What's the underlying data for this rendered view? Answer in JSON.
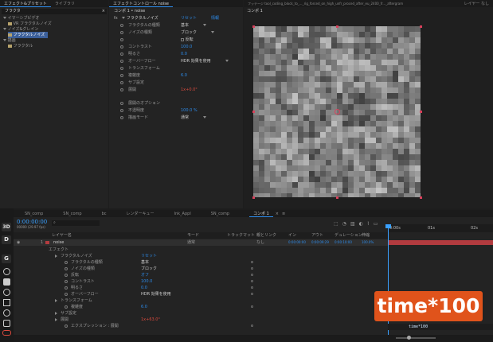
{
  "effects_panel": {
    "tabs": [
      "エフェクト&プリセット",
      "ライブラリ"
    ],
    "search_value": "フラクタ",
    "items": [
      {
        "label": "フラクタ",
        "level": 0,
        "type": "search"
      },
      {
        "label": "イマーシブビデオ",
        "level": 0,
        "type": "category"
      },
      {
        "label": "VR フラクタルノイズ",
        "level": 1,
        "type": "effect"
      },
      {
        "label": "ノイズ&グレイン",
        "level": 0,
        "type": "category"
      },
      {
        "label": "フラクタルノイズ",
        "level": 1,
        "type": "effect",
        "selected": true
      },
      {
        "label": "描画",
        "level": 0,
        "type": "category"
      },
      {
        "label": "フラクタル",
        "level": 1,
        "type": "effect"
      }
    ]
  },
  "effect_controls": {
    "tab_title": "エフェクトコントロール noise",
    "header": "コンポ 1 • noise",
    "effect_name": "フラクタルノイズ",
    "reset_label": "リセット",
    "about_label": "情報",
    "props": [
      {
        "name": "フラクタルの種類",
        "value": "基本",
        "dropdown": true
      },
      {
        "name": "ノイズの種類",
        "value": "ブロック",
        "dropdown": true
      },
      {
        "name": "",
        "value": "反転",
        "checkbox": true
      },
      {
        "name": "コントラスト",
        "value": "100.0"
      },
      {
        "name": "明るさ",
        "value": "0.0"
      },
      {
        "name": "オーバーフロー",
        "value": "HDR 効果を使用",
        "dropdown": true
      },
      {
        "name": "トランスフォーム",
        "value": ""
      },
      {
        "name": "複雑度",
        "value": "6.0"
      },
      {
        "name": "サブ設定",
        "value": ""
      },
      {
        "name": "展開",
        "value": "1x+0.0°"
      },
      {
        "name": "",
        "value": ""
      },
      {
        "name": "展開のオプション",
        "value": ""
      },
      {
        "name": "不透明度",
        "value": "100.0 %"
      },
      {
        "name": "描画モード",
        "value": "通常",
        "dropdown": true
      }
    ]
  },
  "composition": {
    "tab_title": "コンポジション コンポ 1",
    "footage_tab": "フッテージ tool_coding_block_to_..._rig_forced_on_high_unfr_proced_after_eu_2400_fr..._aftergram",
    "layer_tab": "レイヤー なし",
    "viewer_label": "コンポ 1"
  },
  "timeline": {
    "tabs": [
      "レンダーキュー",
      "コンポ 1"
    ],
    "inactive_tabs": [
      "SN_comp",
      "SN_comp",
      "bc",
      "レンダーキュー",
      "Ink_Appl",
      "SN_comp"
    ],
    "timecode": "0:00:00:00",
    "fps_note": "00000 (29.97 fps)",
    "columns": [
      "レイヤー名",
      "モード",
      "トラックマット",
      "親とリンク",
      "イン",
      "アウト",
      "デュレーション",
      "伸縮"
    ],
    "layer": {
      "index": "1",
      "name": "noise",
      "mode": "通常",
      "parent": "なし",
      "in": "0:00:00:00",
      "out": "0:00:09:29",
      "duration": "0:00:10:00",
      "stretch": "100.0%"
    },
    "rows": [
      {
        "label": "エフェクト",
        "value": "",
        "indent": 0
      },
      {
        "label": "フラクタルノイズ",
        "value": "リセット",
        "indent": 1,
        "valueColor": "blue"
      },
      {
        "label": "フラクタルの種類",
        "value": "基本",
        "indent": 2
      },
      {
        "label": "ノイズの種類",
        "value": "ブロック",
        "indent": 2
      },
      {
        "label": "反転",
        "value": "オフ",
        "indent": 2
      },
      {
        "label": "コントラスト",
        "value": "100.0",
        "indent": 2
      },
      {
        "label": "明るさ",
        "value": "0.0",
        "indent": 2
      },
      {
        "label": "オーバーフロー",
        "value": "HDR 効果を使用",
        "indent": 2
      },
      {
        "label": "トランスフォーム",
        "value": "",
        "indent": 1
      },
      {
        "label": "複雑度",
        "value": "6.0",
        "indent": 2
      },
      {
        "label": "サブ設定",
        "value": "",
        "indent": 1
      },
      {
        "label": "展開",
        "value": "1x+63.0°",
        "indent": 1,
        "valueColor": "red"
      },
      {
        "label": "エクスプレッション : 展開",
        "value": "",
        "indent": 2
      }
    ],
    "ruler": [
      "0:00s",
      "01s",
      "02s"
    ],
    "expression": "time*100",
    "annotation": "time*100"
  },
  "toolbar_left": [
    "3D",
    "D",
    "G"
  ],
  "colors": {
    "accent": "#2d8ceb",
    "layer_bar": "#b23b3f",
    "expression_text": "#d94a3e",
    "annotation_bg": "#e0531b"
  }
}
